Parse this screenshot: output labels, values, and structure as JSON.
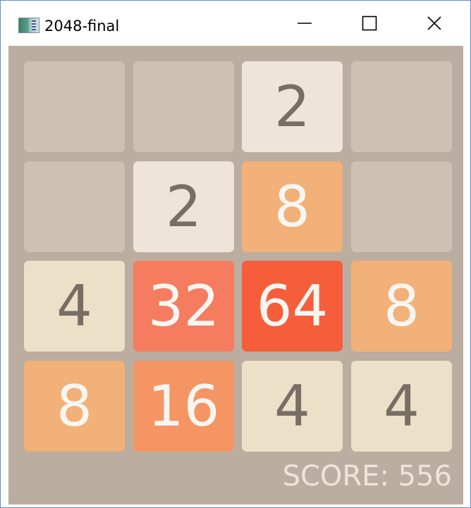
{
  "window": {
    "title": "2048-final",
    "app_icon": "application-icon",
    "controls": {
      "minimize_icon": "minimize-icon",
      "maximize_icon": "maximize-icon",
      "close_icon": "close-icon"
    }
  },
  "colors": {
    "board_background": "#bbada0",
    "empty_cell": "#cdc1b4",
    "dark_text": "#776e65",
    "light_text": "#f9f6f2",
    "tile_2": "#eee4da",
    "tile_4": "#ede0c8",
    "tile_8": "#f2b179",
    "tile_16": "#f59563",
    "tile_32": "#f67c5f",
    "tile_64": "#f65e3b"
  },
  "board": {
    "rows": [
      [
        "",
        "",
        "2",
        ""
      ],
      [
        "",
        "2",
        "8",
        ""
      ],
      [
        "4",
        "32",
        "64",
        "8"
      ],
      [
        "8",
        "16",
        "4",
        "4"
      ]
    ]
  },
  "score": {
    "text": "SCORE: 556"
  }
}
